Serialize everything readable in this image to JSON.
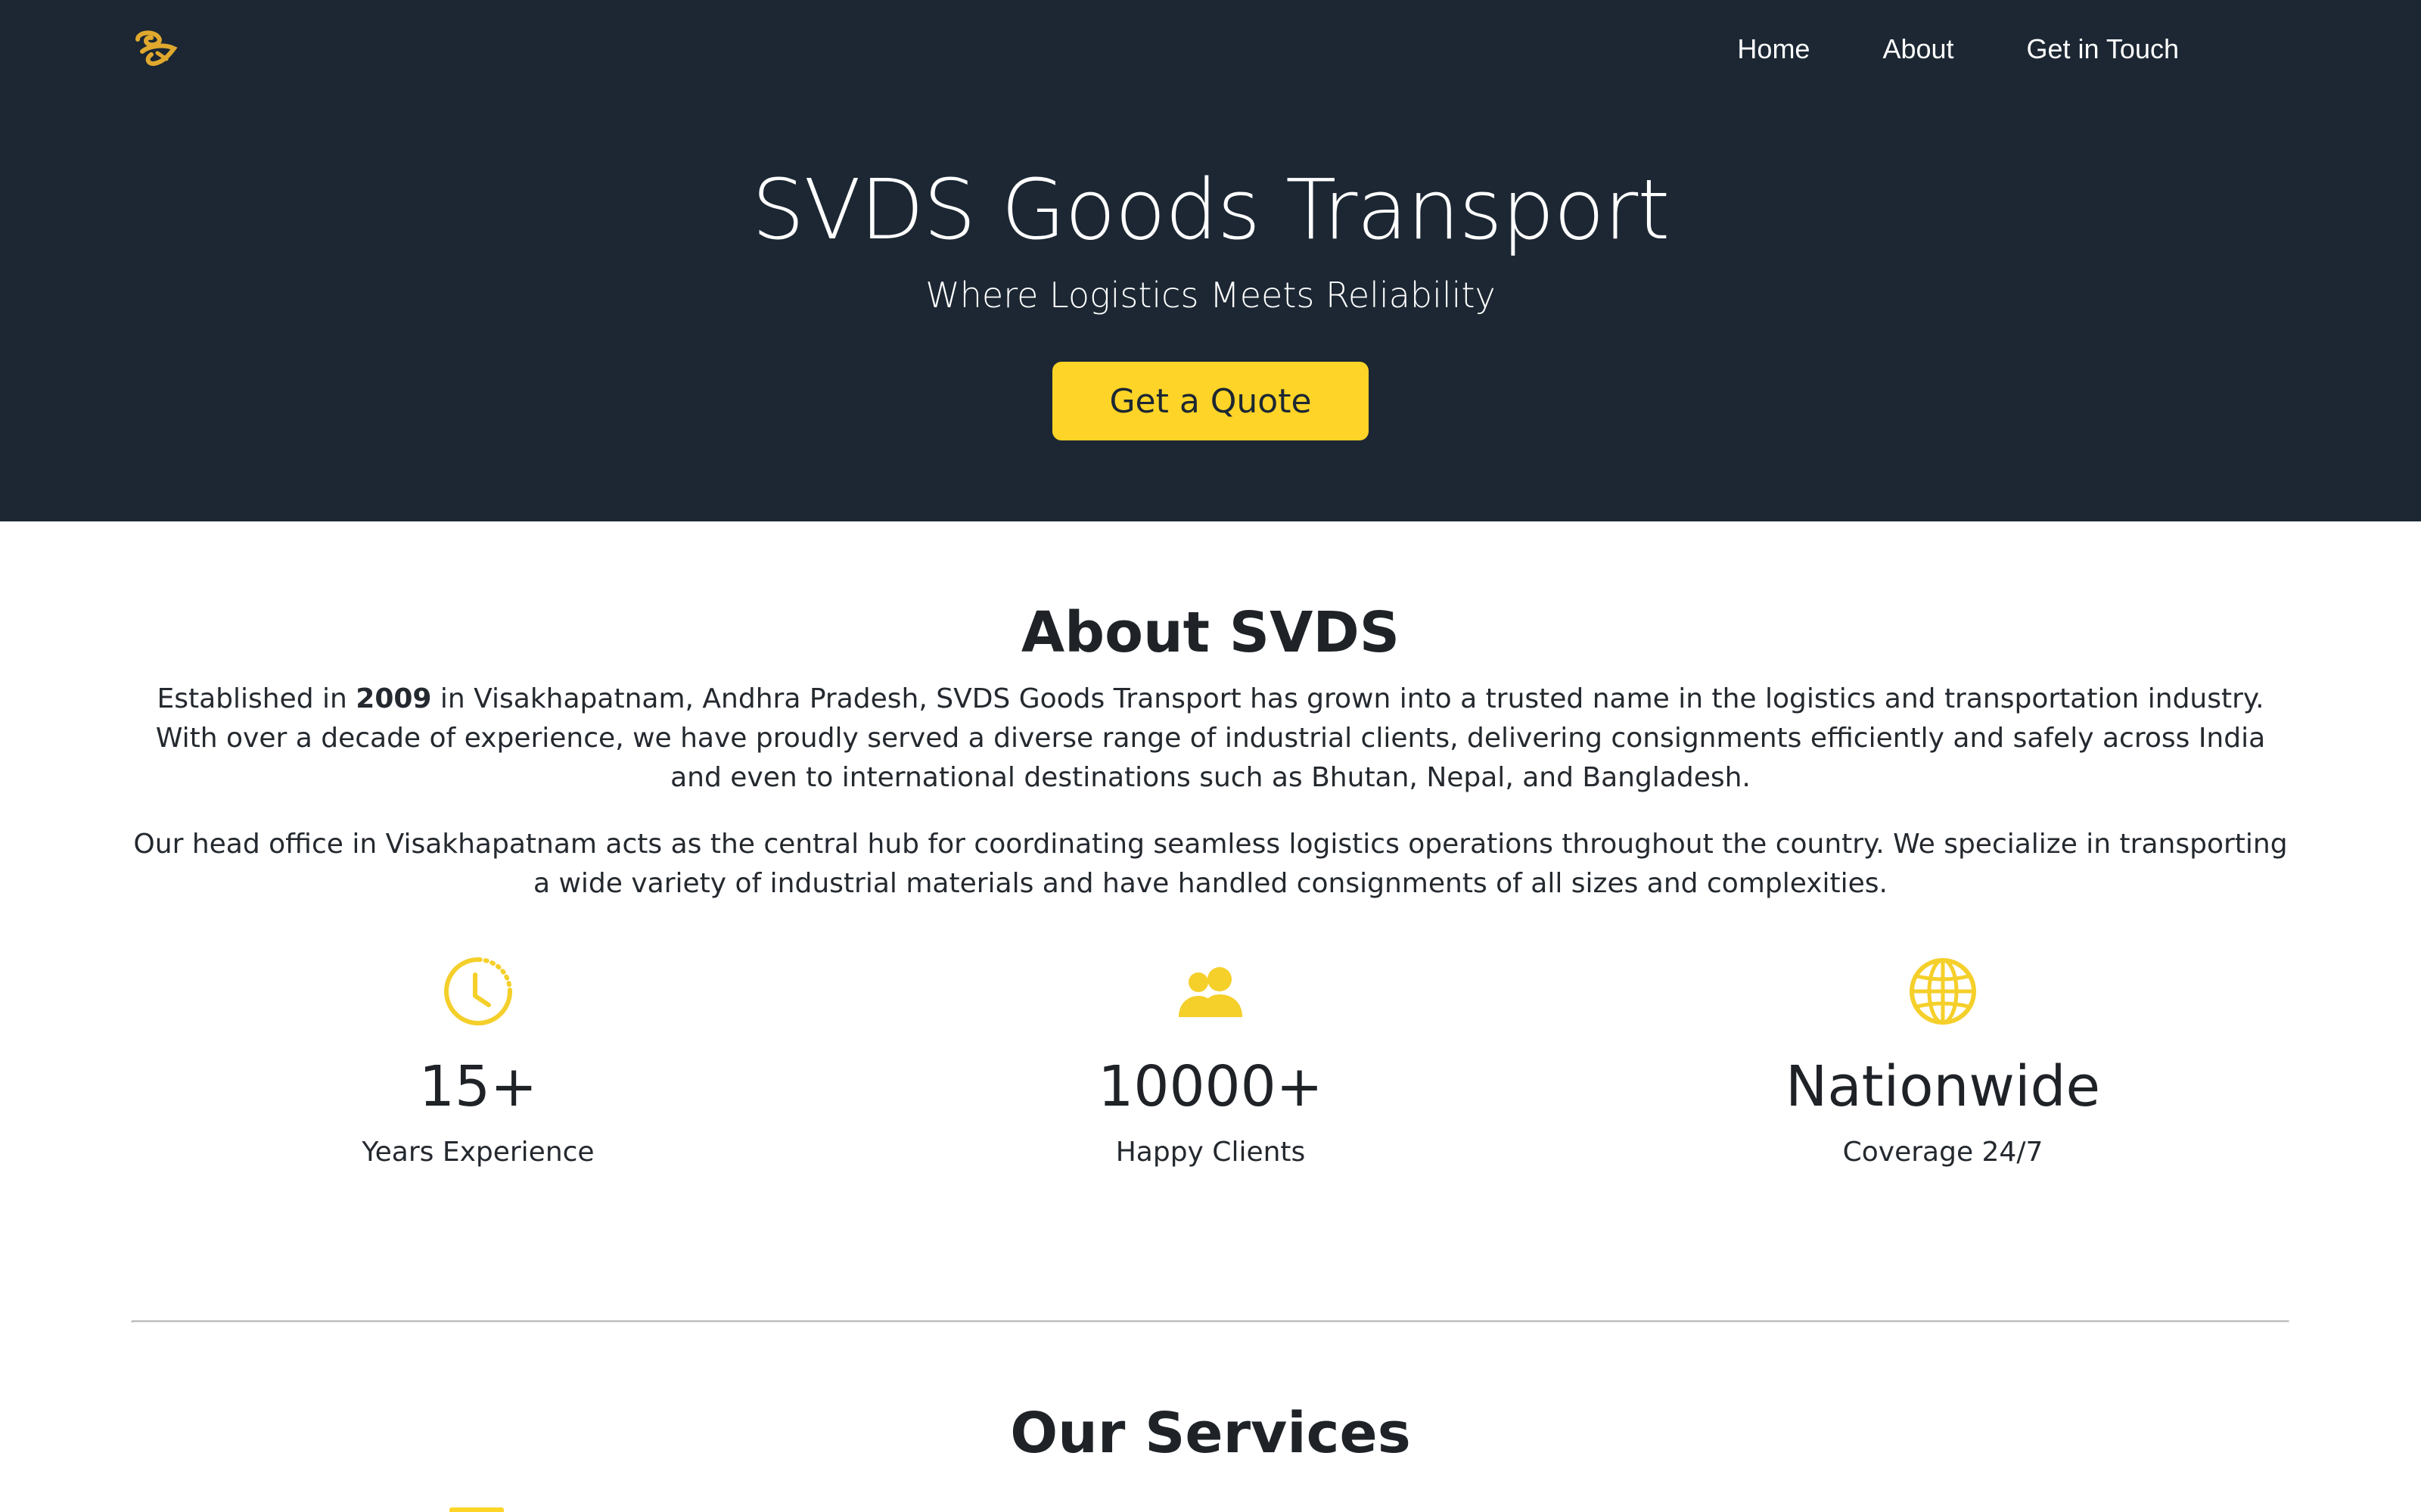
{
  "brand": {
    "logo_icon": "swan-logo-icon",
    "accent_color": "#fdd427",
    "hero_bg": "#1c2733"
  },
  "nav": {
    "items": [
      {
        "label": "Home"
      },
      {
        "label": "About"
      },
      {
        "label": "Get in Touch"
      }
    ]
  },
  "hero": {
    "title": "SVDS Goods Transport",
    "subtitle": "Where Logistics Meets Reliability",
    "cta_label": "Get a Quote"
  },
  "about": {
    "title": "About SVDS",
    "p1_before": "Established in ",
    "p1_year": "2009",
    "p1_after": " in Visakhapatnam, Andhra Pradesh, SVDS Goods Transport has grown into a trusted name in the logistics and transportation industry. With over a decade of experience, we have proudly served a diverse range of industrial clients, delivering consignments efficiently and safely across India and even to international destinations such as Bhutan, Nepal, and Bangladesh.",
    "p2": "Our head office in Visakhapatnam acts as the central hub for coordinating seamless logistics operations throughout the country. We specialize in transporting a wide variety of industrial materials and have handled consignments of all sizes and complexities."
  },
  "stats": [
    {
      "icon": "clock-icon",
      "value": "15+",
      "label": "Years Experience"
    },
    {
      "icon": "users-icon",
      "value": "10000+",
      "label": "Happy Clients"
    },
    {
      "icon": "globe-icon",
      "value": "Nationwide",
      "label": "Coverage 24/7"
    }
  ],
  "services": {
    "title": "Our Services"
  }
}
